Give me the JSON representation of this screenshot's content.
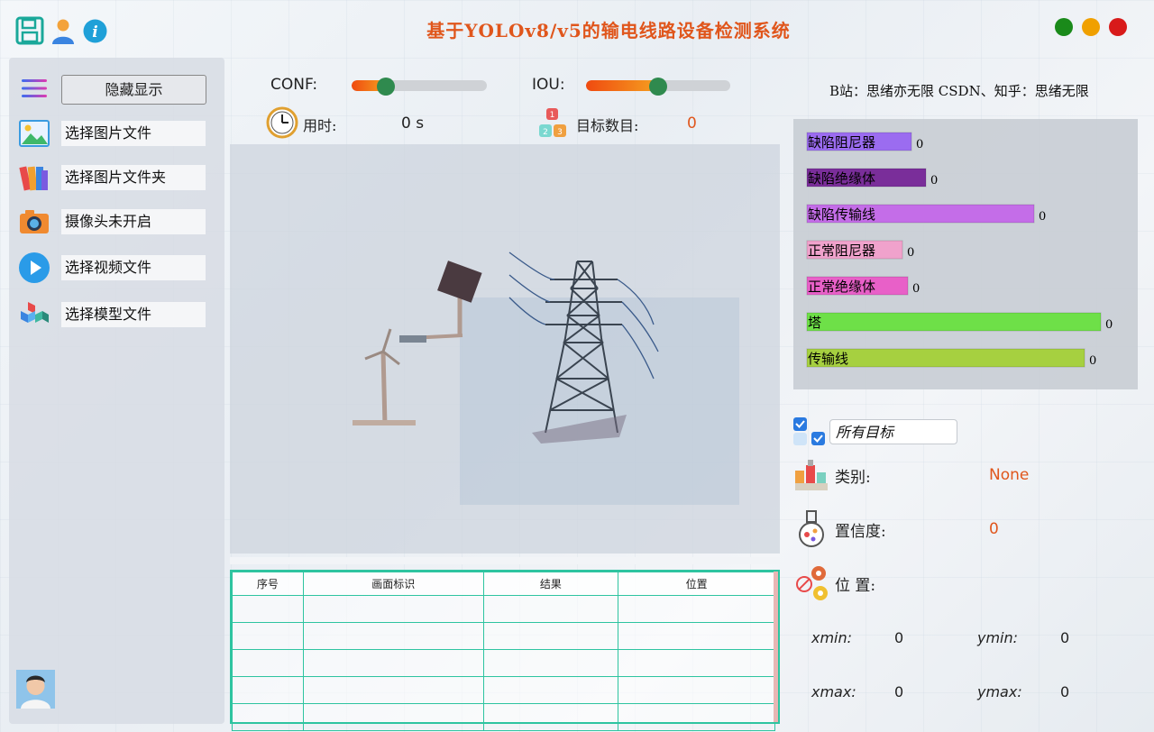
{
  "window": {
    "title": "基于YOLOv8/v5的输电线路设备检测系统",
    "controls": [
      {
        "name": "maximize",
        "color": "#1a8a1a"
      },
      {
        "name": "minimize",
        "color": "#f0a000"
      },
      {
        "name": "close",
        "color": "#d81a1a"
      }
    ]
  },
  "toolbar": {
    "icons": [
      "save-icon",
      "user-icon",
      "info-icon"
    ]
  },
  "sidebar": {
    "menu_icon": "hamburger-icon",
    "toggle_label": "隐藏显示",
    "items": [
      {
        "icon": "image-file-icon",
        "label": "选择图片文件"
      },
      {
        "icon": "image-folder-icon",
        "label": "选择图片文件夹"
      },
      {
        "icon": "camera-icon",
        "label": "摄像头未开启"
      },
      {
        "icon": "play-video-icon",
        "label": "选择视频文件"
      },
      {
        "icon": "model-cubes-icon",
        "label": "选择模型文件"
      }
    ],
    "avatar": "avatar"
  },
  "controls": {
    "conf_label": "CONF:",
    "conf_value": 0.25,
    "iou_label": "IOU:",
    "iou_value": 0.5,
    "time_label": "用时:",
    "time_value": "0 s",
    "count_label": "目标数目:",
    "count_value": "0"
  },
  "credits": "B站：思绪亦无限  CSDN、知乎：思绪无限",
  "table": {
    "columns": [
      "序号",
      "画面标识",
      "结果",
      "位置"
    ],
    "rows": [
      [
        "",
        "",
        "",
        ""
      ],
      [
        "",
        "",
        "",
        ""
      ],
      [
        "",
        "",
        "",
        ""
      ],
      [
        "",
        "",
        "",
        ""
      ],
      [
        "",
        "",
        "",
        ""
      ]
    ]
  },
  "chart_data": {
    "type": "bar",
    "orientation": "horizontal",
    "categories": [
      "缺陷阻尼器",
      "缺陷绝缘体",
      "缺陷传输线",
      "正常阻尼器",
      "正常绝缘体",
      "塔",
      "传输线"
    ],
    "values": [
      0,
      0,
      0,
      0,
      0,
      0,
      0
    ],
    "colors": [
      "#9b6cf0",
      "#7a2e9a",
      "#c46de8",
      "#f0a2cc",
      "#e860c8",
      "#6ee048",
      "#a6d040"
    ]
  },
  "details": {
    "filter_value": "所有目标",
    "class_label": "类别:",
    "class_value": "None",
    "conf_label": "置信度:",
    "conf_value": "0",
    "pos_label": "位 置:",
    "xmin_label": "xmin:",
    "xmin_value": "0",
    "ymin_label": "ymin:",
    "ymin_value": "0",
    "xmax_label": "xmax:",
    "xmax_value": "0",
    "ymax_label": "ymax:",
    "ymax_value": "0"
  }
}
